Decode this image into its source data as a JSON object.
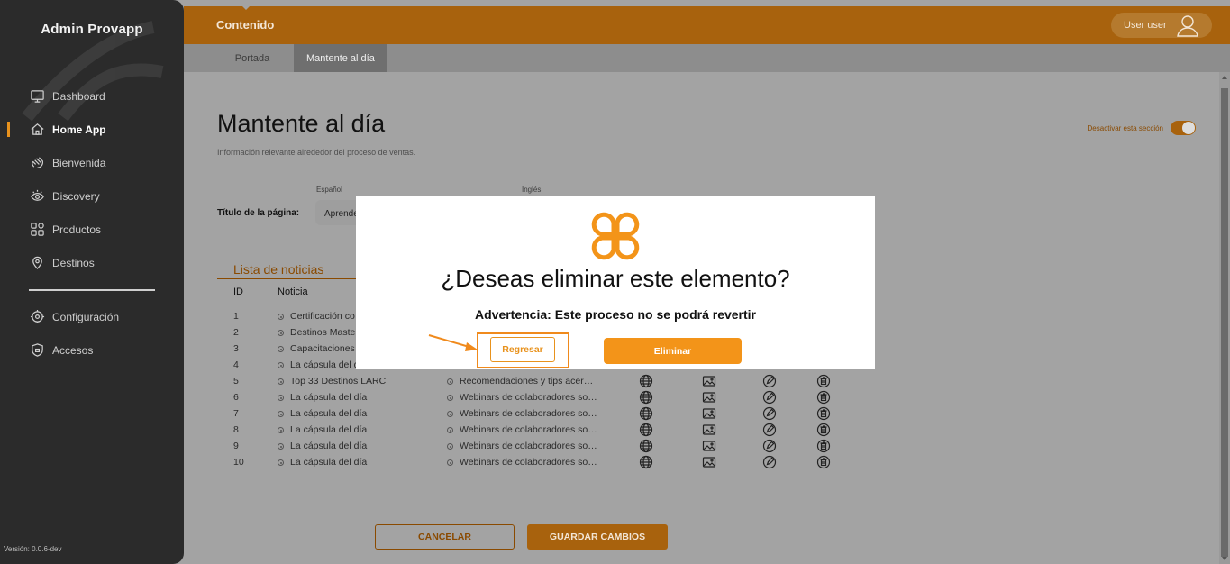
{
  "sidebar": {
    "brand": "Admin Provapp",
    "items": [
      {
        "label": "Dashboard",
        "icon": "monitor-icon"
      },
      {
        "label": "Home App",
        "icon": "home-icon",
        "active": true
      },
      {
        "label": "Bienvenida",
        "icon": "wave-hand-icon"
      },
      {
        "label": "Discovery",
        "icon": "eye-icon"
      },
      {
        "label": "Productos",
        "icon": "grid-icon"
      },
      {
        "label": "Destinos",
        "icon": "map-pin-icon"
      }
    ],
    "items_bottom": [
      {
        "label": "Configuración",
        "icon": "gear-icon"
      },
      {
        "label": "Accesos",
        "icon": "shield-icon"
      }
    ],
    "version": "Versión: 0.0.6-dev"
  },
  "topbar": {
    "title": "Contenido",
    "user": "User user"
  },
  "tabs": [
    "Portada",
    "Mantente al día"
  ],
  "page": {
    "title": "Mantente al día",
    "subtitle": "Información relevante alrededor del proceso de ventas.",
    "toggle_label": "Desactivar esta sección",
    "lang_es": "Español",
    "lang_en": "Inglés",
    "field_label": "Título de la página:",
    "field_value": "Aprende"
  },
  "list": {
    "title": "Lista de noticias",
    "col_id": "ID",
    "col_noticia": "Noticia",
    "rows": [
      {
        "id": "1",
        "es": "Certificación co",
        "en": ""
      },
      {
        "id": "2",
        "es": "Destinos Maste",
        "en": ""
      },
      {
        "id": "3",
        "es": "Capacitaciones",
        "en": ""
      },
      {
        "id": "4",
        "es": "La cápsula del d",
        "en": ""
      },
      {
        "id": "5",
        "es": "Top 33 Destinos LARC",
        "en": "Recomendaciones y tips acer…"
      },
      {
        "id": "6",
        "es": "La cápsula del día",
        "en": "Webinars de colaboradores so…"
      },
      {
        "id": "7",
        "es": "La cápsula del día",
        "en": "Webinars de colaboradores so…"
      },
      {
        "id": "8",
        "es": "La cápsula del día",
        "en": "Webinars de colaboradores so…"
      },
      {
        "id": "9",
        "es": "La cápsula del día",
        "en": "Webinars de colaboradores so…"
      },
      {
        "id": "10",
        "es": "La cápsula del día",
        "en": "Webinars de colaboradores so…"
      }
    ]
  },
  "buttons": {
    "cancel": "CANCELAR",
    "save": "GUARDAR CAMBIOS"
  },
  "modal": {
    "title": "¿Deseas eliminar este elemento?",
    "warning": "Advertencia: Este proceso no se podrá revertir",
    "back": "Regresar",
    "delete": "Eliminar"
  },
  "colors": {
    "accent": "#f39419",
    "topbar": "#a8620d",
    "sidebar": "#2b2b2b"
  }
}
